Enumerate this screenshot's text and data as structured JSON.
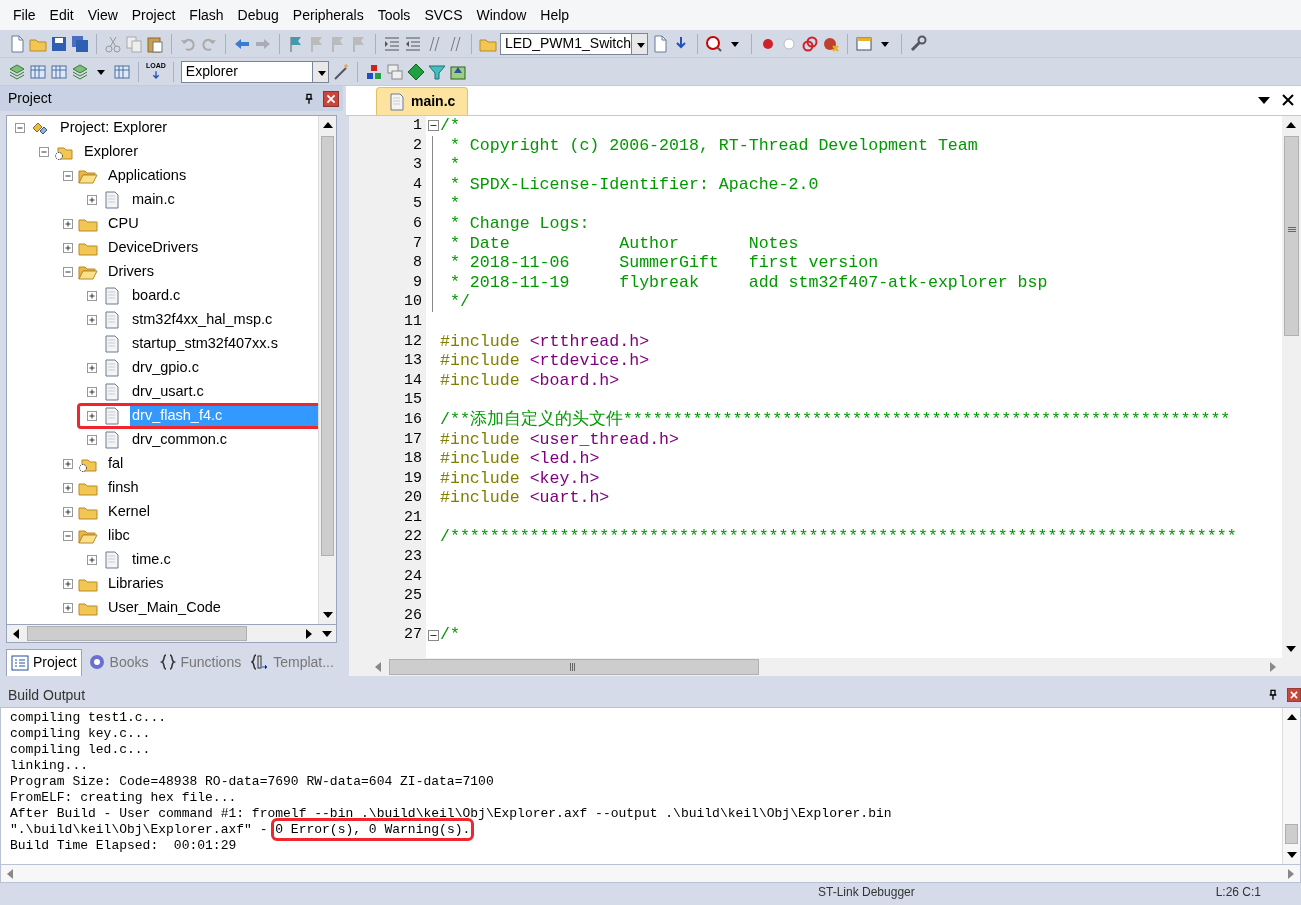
{
  "menu": [
    "File",
    "Edit",
    "View",
    "Project",
    "Flash",
    "Debug",
    "Peripherals",
    "Tools",
    "SVCS",
    "Window",
    "Help"
  ],
  "toolbar": {
    "target": "LED_PWM1_Switch",
    "load_label": "LOAD",
    "project_combo": "Explorer"
  },
  "project_panel": {
    "title": "Project",
    "tree": [
      {
        "label": "Project: Explorer",
        "kind": "project",
        "expanded": true,
        "selected": false,
        "children": [
          {
            "label": "Explorer",
            "kind": "target",
            "expanded": true,
            "selected": false,
            "children": [
              {
                "label": "Applications",
                "kind": "folder",
                "expanded": true,
                "selected": false,
                "children": [
                  {
                    "label": "main.c",
                    "kind": "file",
                    "expanded": false,
                    "selected": false
                  }
                ]
              },
              {
                "label": "CPU",
                "kind": "folder",
                "expanded": false,
                "selected": false
              },
              {
                "label": "DeviceDrivers",
                "kind": "folder",
                "expanded": false,
                "selected": false
              },
              {
                "label": "Drivers",
                "kind": "folder",
                "expanded": true,
                "selected": false,
                "children": [
                  {
                    "label": "board.c",
                    "kind": "file",
                    "expanded": false,
                    "selected": false
                  },
                  {
                    "label": "stm32f4xx_hal_msp.c",
                    "kind": "file",
                    "expanded": false,
                    "selected": false
                  },
                  {
                    "label": "startup_stm32f407xx.s",
                    "kind": "file",
                    "selected": false
                  },
                  {
                    "label": "drv_gpio.c",
                    "kind": "file",
                    "expanded": false,
                    "selected": false
                  },
                  {
                    "label": "drv_usart.c",
                    "kind": "file",
                    "expanded": false,
                    "selected": false
                  },
                  {
                    "label": "drv_flash_f4.c",
                    "kind": "file",
                    "expanded": false,
                    "selected": true,
                    "annotated": true
                  },
                  {
                    "label": "drv_common.c",
                    "kind": "file",
                    "expanded": false,
                    "selected": false
                  }
                ]
              },
              {
                "label": "fal",
                "kind": "target",
                "expanded": false,
                "selected": false
              },
              {
                "label": "finsh",
                "kind": "folder",
                "expanded": false,
                "selected": false
              },
              {
                "label": "Kernel",
                "kind": "folder",
                "expanded": false,
                "selected": false
              },
              {
                "label": "libc",
                "kind": "folder",
                "expanded": true,
                "selected": false,
                "children": [
                  {
                    "label": "time.c",
                    "kind": "file",
                    "expanded": false,
                    "selected": false
                  }
                ]
              },
              {
                "label": "Libraries",
                "kind": "folder",
                "expanded": false,
                "selected": false
              },
              {
                "label": "User_Main_Code",
                "kind": "folder",
                "expanded": false,
                "selected": false
              }
            ]
          }
        ]
      }
    ],
    "tabs": [
      {
        "label": "Project",
        "kind": "project",
        "selected": true
      },
      {
        "label": "Books",
        "kind": "books",
        "selected": false
      },
      {
        "label": "Functions",
        "kind": "functions",
        "selected": false
      },
      {
        "label": "Templat...",
        "kind": "templates",
        "selected": false
      }
    ]
  },
  "editor": {
    "tab": {
      "label": "main.c",
      "selected": true
    },
    "lines": [
      {
        "number": "1",
        "kind": "comment",
        "text": "/*",
        "fold": true
      },
      {
        "number": "2",
        "kind": "comment",
        "text": " * Copyright (c) 2006-2018, RT-Thread Development Team",
        "in_fold": true
      },
      {
        "number": "3",
        "kind": "comment",
        "text": " *",
        "in_fold": true
      },
      {
        "number": "4",
        "kind": "comment",
        "text": " * SPDX-License-Identifier: Apache-2.0",
        "in_fold": true
      },
      {
        "number": "5",
        "kind": "comment",
        "text": " *",
        "in_fold": true
      },
      {
        "number": "6",
        "kind": "comment",
        "text": " * Change Logs:",
        "in_fold": true
      },
      {
        "number": "7",
        "kind": "comment",
        "text": " * Date           Author       Notes",
        "in_fold": true
      },
      {
        "number": "8",
        "kind": "comment",
        "text": " * 2018-11-06     SummerGift   first version",
        "in_fold": true
      },
      {
        "number": "9",
        "kind": "comment",
        "text": " * 2018-11-19     flybreak     add stm32f407-atk-explorer bsp",
        "in_fold": true
      },
      {
        "number": "10",
        "kind": "comment",
        "text": " */",
        "in_fold": true
      },
      {
        "number": "11",
        "kind": "blank"
      },
      {
        "number": "12",
        "kind": "include",
        "directive": "#include",
        "text": "<rtthread.h>"
      },
      {
        "number": "13",
        "kind": "include",
        "directive": "#include",
        "text": "<rtdevice.h>"
      },
      {
        "number": "14",
        "kind": "include",
        "directive": "#include",
        "text": "<board.h>"
      },
      {
        "number": "15",
        "kind": "blank"
      },
      {
        "number": "16",
        "kind": "comment",
        "text": "/**添加自定义的头文件*************************************************************"
      },
      {
        "number": "17",
        "kind": "include",
        "directive": "#include",
        "text": "<user_thread.h>"
      },
      {
        "number": "18",
        "kind": "include",
        "directive": "#include",
        "text": "<led.h>"
      },
      {
        "number": "19",
        "kind": "include",
        "directive": "#include",
        "text": "<key.h>"
      },
      {
        "number": "20",
        "kind": "include",
        "directive": "#include",
        "text": "<uart.h>"
      },
      {
        "number": "21",
        "kind": "blank"
      },
      {
        "number": "22",
        "kind": "comment",
        "text": "/*******************************************************************************"
      },
      {
        "number": "23",
        "kind": "blank"
      },
      {
        "number": "24",
        "kind": "blank"
      },
      {
        "number": "25",
        "kind": "blank"
      },
      {
        "number": "26",
        "kind": "blank"
      },
      {
        "number": "27",
        "kind": "comment",
        "text": "/*",
        "fold": true
      }
    ]
  },
  "build_output": {
    "title": "Build Output",
    "lines": [
      {
        "text": "compiling test1.c..."
      },
      {
        "text": "compiling key.c..."
      },
      {
        "text": "compiling led.c..."
      },
      {
        "text": "linking..."
      },
      {
        "text": "Program Size: Code=48938 RO-data=7690 RW-data=604 ZI-data=7100"
      },
      {
        "text": "FromELF: creating hex file..."
      },
      {
        "text": "After Build - User command #1: fromelf --bin .\\build\\keil\\Obj\\Explorer.axf --output .\\build\\keil\\Obj\\Explorer.bin"
      },
      {
        "text": "\".\\build\\keil\\Obj\\Explorer.axf\" - ",
        "highlight": "0 Error(s), 0 Warning(s)."
      },
      {
        "text": "Build Time Elapsed:  00:01:29"
      }
    ]
  },
  "status_bar": {
    "debugger": "ST-Link Debugger",
    "position": "L:26 C:1"
  }
}
